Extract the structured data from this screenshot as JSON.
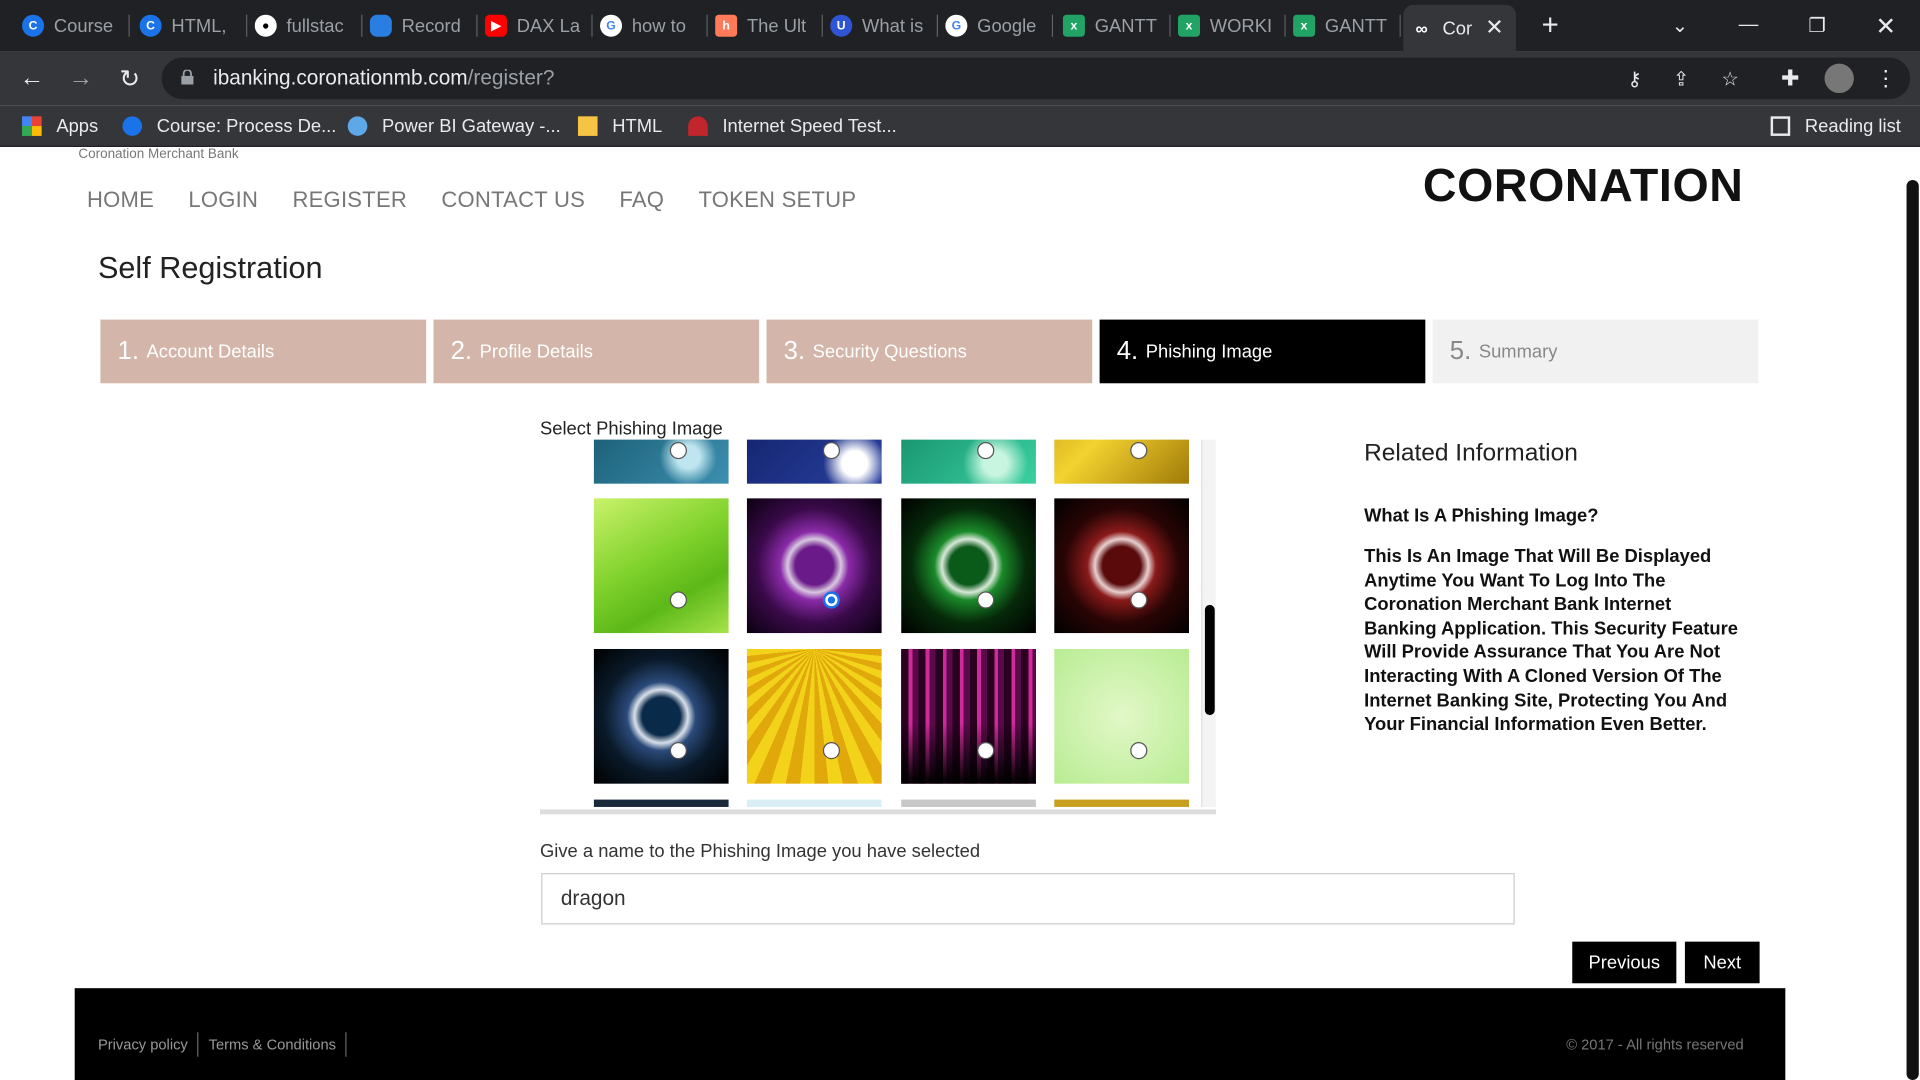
{
  "browser": {
    "tabs": [
      {
        "label": "Course",
        "icon": "coursera-icon",
        "color": "#1a73e8"
      },
      {
        "label": "HTML,",
        "icon": "coursera-icon",
        "color": "#1a73e8"
      },
      {
        "label": "fullstac",
        "icon": "github-icon",
        "color": "#ffffff"
      },
      {
        "label": "Record",
        "icon": "onedrive-icon",
        "color": "#2a7de1"
      },
      {
        "label": "DAX La",
        "icon": "youtube-icon",
        "color": "#ff0000"
      },
      {
        "label": "how to",
        "icon": "google-icon",
        "color": "#ffffff"
      },
      {
        "label": "The Ult",
        "icon": "hubspot-icon",
        "color": "#ff7a59"
      },
      {
        "label": "What is",
        "icon": "u-icon",
        "color": "#2f55d4"
      },
      {
        "label": "Google",
        "icon": "google-icon",
        "color": "#ffffff"
      },
      {
        "label": "GANTT",
        "icon": "excel-icon",
        "color": "#21a366"
      },
      {
        "label": "WORKI",
        "icon": "excel-icon",
        "color": "#21a366"
      },
      {
        "label": "GANTT",
        "icon": "excel-icon",
        "color": "#21a366"
      },
      {
        "label": "Cor",
        "icon": "coronation-icon",
        "color": "#ffffff"
      }
    ],
    "url_host": "ibanking.coronationmb.com",
    "url_path": "/register?",
    "bookmarks": [
      {
        "label": "Apps"
      },
      {
        "label": "Course: Process De..."
      },
      {
        "label": "Power BI Gateway -..."
      },
      {
        "label": "HTML"
      },
      {
        "label": "Internet Speed Test..."
      }
    ],
    "reading_list": "Reading list"
  },
  "site": {
    "bank_small": "Coronation Merchant Bank",
    "logo": "CORONATION",
    "nav": [
      "HOME",
      "LOGIN",
      "REGISTER",
      "CONTACT US",
      "FAQ",
      "TOKEN SETUP"
    ],
    "title": "Self Registration",
    "steps": [
      {
        "num": "1.",
        "label": "Account Details"
      },
      {
        "num": "2.",
        "label": "Profile Details"
      },
      {
        "num": "3.",
        "label": "Security Questions"
      },
      {
        "num": "4.",
        "label": "Phishing Image"
      },
      {
        "num": "5.",
        "label": "Summary"
      }
    ],
    "select_label": "Select Phishing Image",
    "related": {
      "title": "Related Information",
      "question": "What Is A Phishing Image?",
      "answer": "This Is An Image That Will Be Displayed Anytime You Want To Log Into The Coronation Merchant Bank Internet Banking Application. This Security Feature Will Provide Assurance That You Are Not Interacting With A Cloned Version Of The Internet Banking Site, Protecting You And Your Financial Information Even Better."
    },
    "name_label": "Give a name to the Phishing Image you have selected",
    "name_value": "dragon",
    "previous": "Previous",
    "next": "Next",
    "footer": {
      "privacy": "Privacy policy",
      "terms": "Terms & Conditions",
      "copyright": "© 2017 - All rights reserved"
    }
  }
}
